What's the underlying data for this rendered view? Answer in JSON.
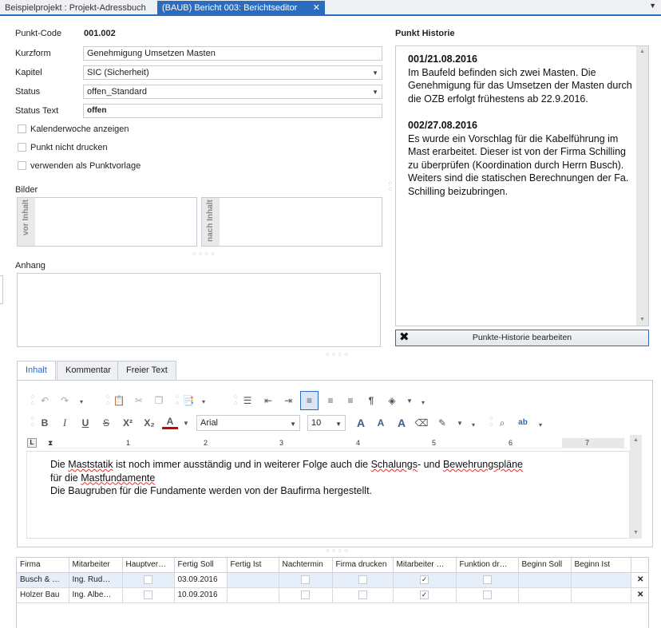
{
  "tabs": {
    "inactive": "Beispielprojekt : Projekt-Adressbuch",
    "active": "(BAUB) Bericht 003: Berichtseditor",
    "close": "✕",
    "dropdown": "▼"
  },
  "form": {
    "punkt_code_label": "Punkt-Code",
    "punkt_code_value": "001.002",
    "kurzform_label": "Kurzform",
    "kurzform_value": "Genehmigung Umsetzen Masten",
    "kapitel_label": "Kapitel",
    "kapitel_value": "SIC (Sicherheit)",
    "status_label": "Status",
    "status_value": "offen_Standard",
    "status_text_label": "Status Text",
    "status_text_value": "offen",
    "checkboxes": [
      "Kalenderwoche anzeigen",
      "Punkt nicht drucken",
      "verwenden als Punktvorlage"
    ],
    "bilder_label": "Bilder",
    "bilder_left": "vor Inhalt",
    "bilder_right": "nach Inhalt",
    "anhang_label": "Anhang"
  },
  "historie": {
    "title": "Punkt Historie",
    "entries": [
      {
        "head": "001/21.08.2016",
        "body": "Im Baufeld befinden sich zwei Masten. Die Genehmigung für das Umsetzen der Masten durch die OZB erfolgt frühestens ab 22.9.2016."
      },
      {
        "head": "002/27.08.2016",
        "body": "Es wurde ein Vorschlag für die Kabelführung im Mast erarbeitet. Dieser ist von der Firma Schilling zu überprüfen (Koordination durch Herrn Busch). Weiters sind die statischen Berechnungen der Fa. Schilling beizubringen."
      }
    ],
    "button": "Punkte-Historie bearbeiten"
  },
  "editor": {
    "tabs": [
      "Inhalt",
      "Kommentar",
      "Freier Text"
    ],
    "font": "Arial",
    "size": "10",
    "text": {
      "l1a": "Die ",
      "l1b": "Maststatik",
      "l1c": " ist noch immer ausständig und in weiterer Folge auch die ",
      "l1d": "Schalungs",
      "l1e": "- und ",
      "l1f": "Bewehrungspläne",
      "l2a": "für die ",
      "l2b": "Mastfundamente",
      "l3": "Die Baugruben für die Fundamente werden von der Baufirma hergestellt."
    },
    "ruler": [
      "1",
      "2",
      "3",
      "4",
      "5",
      "6",
      "7"
    ]
  },
  "grid": {
    "columns": [
      "Firma",
      "Mitarbeiter",
      "Hauptver…",
      "Fertig Soll",
      "Fertig Ist",
      "Nachtermin",
      "Firma drucken",
      "Mitarbeiter …",
      "Funktion dr…",
      "Beginn Soll",
      "Beginn Ist"
    ],
    "rows": [
      {
        "firma": "Busch & …",
        "mitarbeiter": "Ing. Rud…",
        "fertig_soll": "03.09.2016",
        "mit_druck": "✓",
        "del": "✕"
      },
      {
        "firma": "Holzer Bau",
        "mitarbeiter": "Ing. Albe…",
        "fertig_soll": "10.09.2016",
        "mit_druck": "✓",
        "del": "✕"
      }
    ]
  }
}
